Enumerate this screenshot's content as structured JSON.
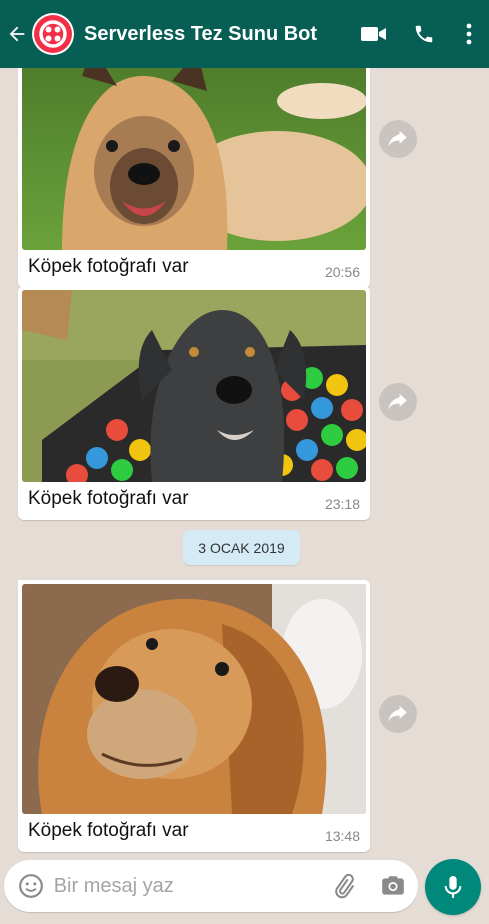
{
  "header": {
    "title": "Serverless Tez Sunu Bot",
    "back_icon": "arrow-left-icon",
    "avatar_icon": "twilio-logo-icon",
    "video_icon": "video-camera-icon",
    "call_icon": "phone-icon",
    "menu_icon": "more-vert-icon",
    "color": "#075e54"
  },
  "messages": [
    {
      "caption": "Köpek fotoğrafı var",
      "time": "20:56",
      "image": "tan dog lying on grass"
    },
    {
      "caption": "Köpek fotoğrafı var",
      "time": "23:18",
      "image": "grey labrador in ball pit"
    },
    {
      "caption": "Köpek fotoğrafı var",
      "time": "13:48",
      "image": "golden retriever close-up"
    }
  ],
  "date_chip": "3 OCAK 2019",
  "composer": {
    "placeholder": "Bir mesaj yaz",
    "emoji_icon": "emoji-icon",
    "attach_icon": "paperclip-icon",
    "camera_icon": "camera-icon",
    "mic_icon": "microphone-icon",
    "accent": "#00897b"
  },
  "colors": {
    "chat_bg": "#e5ddd5",
    "date_chip_bg": "#d4eaf4"
  }
}
